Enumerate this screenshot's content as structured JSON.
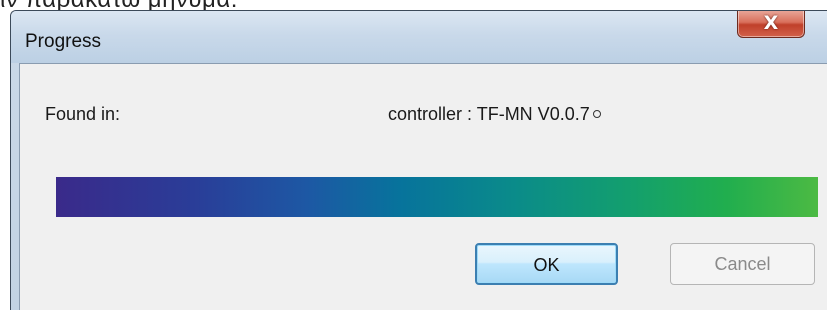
{
  "background": {
    "text": "ιν παρακάτω μήνυμα:"
  },
  "window": {
    "title": "Progress",
    "close_label": "X"
  },
  "content": {
    "found_label": "Found in:",
    "found_value": "controller : TF-MN V0.0.7"
  },
  "progress": {
    "percent": 100,
    "colors": [
      "#3a2a8a",
      "#07739c",
      "#4cba43"
    ]
  },
  "buttons": {
    "ok_label": "OK",
    "cancel_label": "Cancel",
    "cancel_disabled": true
  }
}
